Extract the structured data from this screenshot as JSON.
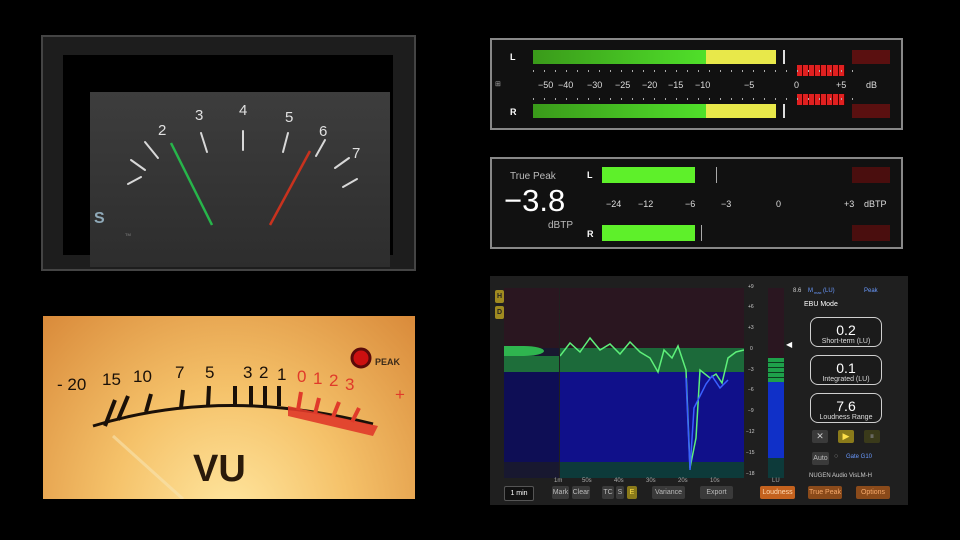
{
  "analog_meter": {
    "scale": [
      "2",
      "3",
      "4",
      "5",
      "6",
      "7"
    ],
    "logo": "S",
    "tm": "TM"
  },
  "vu_meter": {
    "scale": [
      "- 20",
      "15",
      "10",
      "7",
      "5",
      "3",
      "2",
      "1",
      "0",
      "1",
      "2",
      "3"
    ],
    "peak": "PEAK",
    "plus": "+",
    "title": "VU"
  },
  "db_meter": {
    "left": "L",
    "right": "R",
    "scale": [
      "−50",
      "−40",
      "−30",
      "−25",
      "−20",
      "−15",
      "−10",
      "−5",
      "0",
      "+5"
    ],
    "unit": "dB",
    "left_level": 0.74,
    "right_level": 0.74
  },
  "true_peak": {
    "title": "True Peak",
    "value": "−3.8",
    "unit": "dBTP",
    "left": "L",
    "right": "R",
    "scale": [
      "−24",
      "−12",
      "−6",
      "−3",
      "0",
      "+3"
    ],
    "scale_unit": "dBTP"
  },
  "loudness": {
    "h_btn": "H",
    "d_btn": "D",
    "right_scale": [
      "+9",
      "+6",
      "+3",
      "0",
      "−3",
      "−6",
      "−9",
      "−12",
      "−15",
      "−18"
    ],
    "time_axis": [
      "1m",
      "50s",
      "40s",
      "30s",
      "20s",
      "10s"
    ],
    "lu_label": "LU",
    "header_left": "8.6",
    "header_mid": "M",
    "header_sub": "max",
    "header_unit": "(LU)",
    "header_right": "Peak",
    "mode": "EBU Mode",
    "short_term_value": "0.2",
    "short_term_label": "Short-term (LU)",
    "integrated_value": "0.1",
    "integrated_label": "Integrated (LU)",
    "range_value": "7.6",
    "range_label": "Loudness Range",
    "auto": "Auto",
    "gate": "Gate G10",
    "brand": "NUGEN Audio VisLM-H",
    "btn_1min": "1 min",
    "btn_mark": "Mark",
    "btn_clear": "Clear",
    "btn_tc": "TC",
    "btn_s": "S",
    "btn_e": "E",
    "btn_variance": "Variance",
    "btn_export": "Export",
    "btn_loudness": "Loudness",
    "btn_truepeak": "True Peak",
    "btn_options": "Options",
    "colors": {
      "green": "#3cdc5c",
      "blue": "#1010a0",
      "accent": "#e07a2a"
    }
  }
}
